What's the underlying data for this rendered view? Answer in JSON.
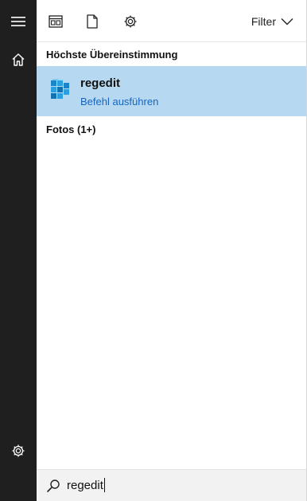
{
  "rail": {
    "icons": [
      "hamburger-menu-icon",
      "home-icon",
      "settings-gear-icon"
    ]
  },
  "toolbar": {
    "icons": [
      "apps-icon",
      "documents-icon",
      "web-settings-gear-icon"
    ],
    "filter_label": "Filter"
  },
  "sections": {
    "best_match": "Höchste Übereinstimmung",
    "photos": "Fotos (1+)"
  },
  "result": {
    "title": "regedit",
    "subtitle": "Befehl ausführen",
    "icon": "registry-cubes-icon"
  },
  "search": {
    "value": "regedit"
  },
  "colors": {
    "rail": "#1f1f1f",
    "highlight": "#b7d8f1",
    "link": "#1565c0"
  }
}
